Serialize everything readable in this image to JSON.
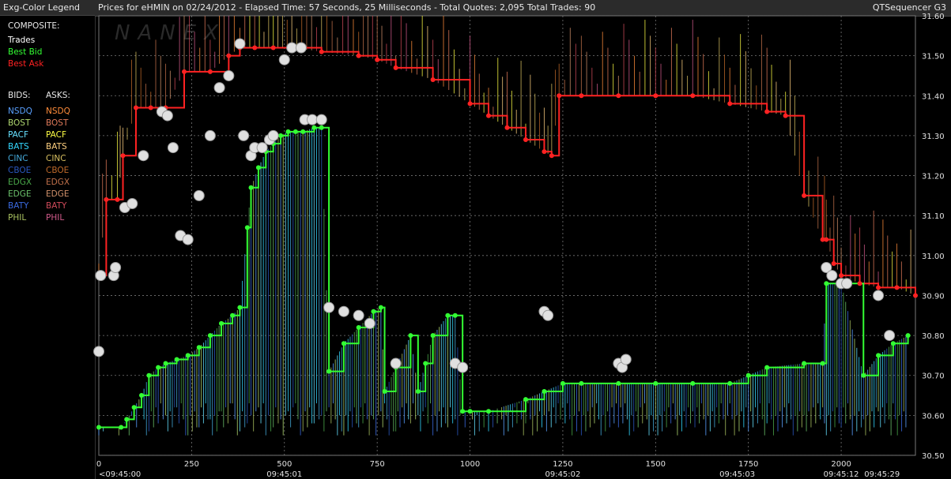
{
  "legend": {
    "title": "Exg-Color Legend",
    "composite_label": "COMPOSITE:",
    "composite": [
      {
        "label": "Trades",
        "color": "#ffffff"
      },
      {
        "label": "Best Bid",
        "color": "#33ff33"
      },
      {
        "label": "Best Ask",
        "color": "#ff2222"
      }
    ],
    "bids_label": "BIDS:",
    "asks_label": "ASKS:",
    "exchanges": [
      {
        "bid": "NSDQ",
        "ask": "NSDQ",
        "bid_color": "#5aa0ff",
        "ask_color": "#ff8c3a"
      },
      {
        "bid": "BOST",
        "ask": "BOST",
        "bid_color": "#b0d870",
        "ask_color": "#e07a5a"
      },
      {
        "bid": "PACF",
        "ask": "PACF",
        "bid_color": "#66e0ff",
        "ask_color": "#ffff44"
      },
      {
        "bid": "BATS",
        "ask": "BATS",
        "bid_color": "#33d8ff",
        "ask_color": "#ffd080"
      },
      {
        "bid": "CINC",
        "ask": "CINC",
        "bid_color": "#44a8d8",
        "ask_color": "#d8c060"
      },
      {
        "bid": "CBOE",
        "ask": "CBOE",
        "bid_color": "#2a58c0",
        "ask_color": "#c06a2a"
      },
      {
        "bid": "EDGX",
        "ask": "EDGX",
        "bid_color": "#4aa84a",
        "ask_color": "#c0704a"
      },
      {
        "bid": "EDGE",
        "ask": "EDGE",
        "bid_color": "#6ac06a",
        "ask_color": "#d0906a"
      },
      {
        "bid": "BATY",
        "ask": "BATY",
        "bid_color": "#3a6ae0",
        "ask_color": "#d04a5a"
      },
      {
        "bid": "PHIL",
        "ask": "PHIL",
        "bid_color": "#a8c060",
        "ask_color": "#d05a8a"
      }
    ]
  },
  "header": {
    "text": "Prices for  eHMIN  on  02/24/2012  -  Elapsed Time: 57 Seconds, 25 Milliseconds  -  Total Quotes: 2,095  Total Trades: 90",
    "product": "QTSequencer G3"
  },
  "watermark": "NANEX",
  "chart_data": {
    "type": "line",
    "xlim": [
      0,
      2200
    ],
    "ylim": [
      30.5,
      31.6
    ],
    "grid": true,
    "x_ticks": [
      0,
      250,
      500,
      750,
      1000,
      1250,
      1500,
      1750,
      2000
    ],
    "x_tick_labels": [
      "0",
      "250",
      "500",
      "750",
      "1000",
      "1250",
      "1500",
      "1750",
      "2000"
    ],
    "time_labels": [
      {
        "x": 0,
        "label": "<09:45:00"
      },
      {
        "x": 500,
        "label": "09:45:01"
      },
      {
        "x": 1250,
        "label": "09:45:02"
      },
      {
        "x": 1720,
        "label": "09:45:03"
      },
      {
        "x": 2000,
        "label": "09:45:12"
      },
      {
        "x": 2110,
        "label": "09:45:29"
      }
    ],
    "y_ticks": [
      30.5,
      30.6,
      30.7,
      30.8,
      30.9,
      31.0,
      31.1,
      31.2,
      31.3,
      31.4,
      31.5,
      31.6
    ],
    "y_tick_labels": [
      "30.50",
      "30.60",
      "30.70",
      "30.80",
      "30.90",
      "31.00",
      "31.10",
      "31.20",
      "31.30",
      "31.40",
      "31.50",
      "31.60"
    ],
    "series": [
      {
        "name": "Best Bid",
        "color": "#33ff33",
        "x": [
          0,
          60,
          75,
          95,
          115,
          135,
          160,
          180,
          210,
          240,
          270,
          300,
          330,
          360,
          380,
          400,
          410,
          430,
          450,
          470,
          490,
          510,
          530,
          550,
          580,
          600,
          620,
          660,
          700,
          740,
          760,
          770,
          800,
          840,
          860,
          880,
          900,
          940,
          960,
          980,
          1000,
          1050,
          1150,
          1200,
          1250,
          1300,
          1400,
          1500,
          1600,
          1700,
          1750,
          1800,
          1900,
          1950,
          1960,
          2000,
          2060,
          2100,
          2140,
          2180
        ],
        "y": [
          30.57,
          30.57,
          30.59,
          30.62,
          30.65,
          30.7,
          30.72,
          30.73,
          30.74,
          30.75,
          30.77,
          30.8,
          30.83,
          30.85,
          30.87,
          31.07,
          31.17,
          31.22,
          31.26,
          31.28,
          31.3,
          31.31,
          31.31,
          31.31,
          31.32,
          31.32,
          30.71,
          30.78,
          30.82,
          30.86,
          30.87,
          30.66,
          30.72,
          30.8,
          30.66,
          30.73,
          30.8,
          30.85,
          30.85,
          30.61,
          30.61,
          30.61,
          30.64,
          30.66,
          30.68,
          30.68,
          30.68,
          30.68,
          30.68,
          30.68,
          30.7,
          30.72,
          30.73,
          30.73,
          30.93,
          30.93,
          30.7,
          30.75,
          30.78,
          30.8
        ]
      },
      {
        "name": "Best Ask",
        "color": "#ff2222",
        "x": [
          0,
          20,
          50,
          65,
          100,
          140,
          180,
          230,
          300,
          350,
          380,
          420,
          470,
          520,
          600,
          700,
          750,
          800,
          900,
          1000,
          1050,
          1100,
          1150,
          1200,
          1220,
          1240,
          1300,
          1400,
          1500,
          1600,
          1700,
          1800,
          1850,
          1900,
          1950,
          1960,
          1980,
          2000,
          2050,
          2100,
          2150,
          2200
        ],
        "y": [
          30.95,
          31.14,
          31.14,
          31.25,
          31.37,
          31.37,
          31.37,
          31.46,
          31.46,
          31.5,
          31.52,
          31.52,
          31.52,
          31.52,
          31.51,
          31.5,
          31.49,
          31.47,
          31.44,
          31.38,
          31.35,
          31.32,
          31.29,
          31.26,
          31.25,
          31.4,
          31.4,
          31.4,
          31.4,
          31.4,
          31.38,
          31.36,
          31.35,
          31.15,
          31.04,
          31.04,
          30.98,
          30.95,
          30.93,
          30.92,
          30.92,
          30.9
        ]
      },
      {
        "name": "Trades",
        "color": "#e0e0e0",
        "x": [
          0,
          5,
          40,
          45,
          70,
          90,
          120,
          170,
          185,
          200,
          220,
          240,
          270,
          300,
          325,
          350,
          380,
          390,
          410,
          420,
          440,
          460,
          470,
          500,
          520,
          545,
          555,
          575,
          600,
          620,
          660,
          700,
          730,
          800,
          960,
          980,
          1200,
          1210,
          1400,
          1410,
          1420,
          1960,
          1975,
          2000,
          2015,
          2100,
          2130
        ],
        "y": [
          30.76,
          30.95,
          30.95,
          30.97,
          31.12,
          31.13,
          31.25,
          31.36,
          31.35,
          31.27,
          31.05,
          31.04,
          31.15,
          31.3,
          31.42,
          31.45,
          31.53,
          31.3,
          31.25,
          31.27,
          31.27,
          31.29,
          31.3,
          31.49,
          31.52,
          31.52,
          31.34,
          31.34,
          31.34,
          30.87,
          30.86,
          30.85,
          30.83,
          30.73,
          30.73,
          30.72,
          30.86,
          30.85,
          30.73,
          30.72,
          30.74,
          30.97,
          30.95,
          30.93,
          30.93,
          30.9,
          30.8
        ]
      }
    ]
  }
}
